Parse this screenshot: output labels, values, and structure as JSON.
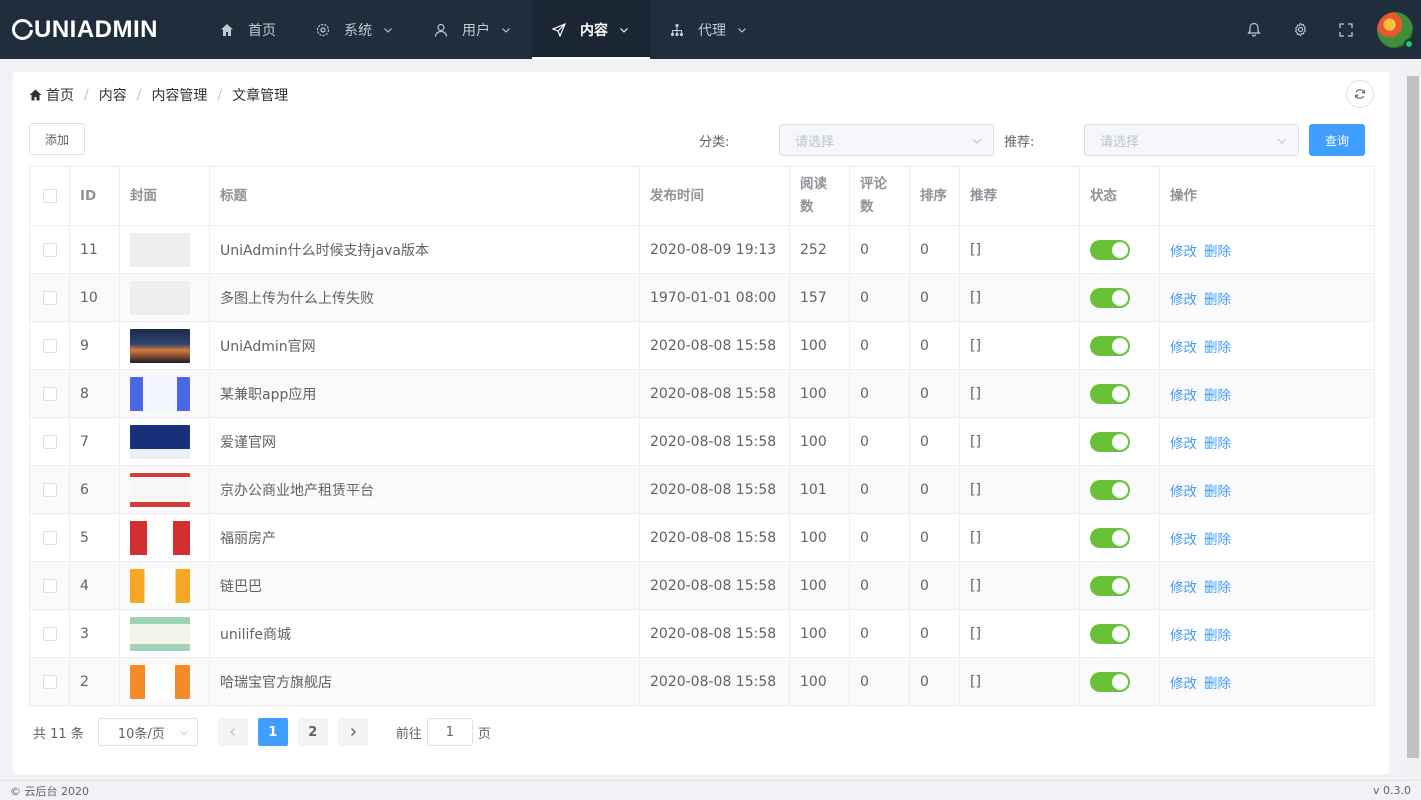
{
  "app": {
    "logo_text": "UNIADMIN",
    "logo_prefix": ""
  },
  "nav": [
    {
      "label": "首页",
      "icon": "home-icon"
    },
    {
      "label": "系统",
      "icon": "gear-icon"
    },
    {
      "label": "用户",
      "icon": "user-icon"
    },
    {
      "label": "内容",
      "icon": "send-icon",
      "active": true
    },
    {
      "label": "代理",
      "icon": "network-icon"
    }
  ],
  "breadcrumb": [
    "首页",
    "内容",
    "内容管理",
    "文章管理"
  ],
  "toolbar": {
    "add_label": "添加",
    "category_label": "分类:",
    "category_placeholder": "请选择",
    "recommend_label": "推荐:",
    "recommend_placeholder": "请选择",
    "query_label": "查询"
  },
  "table": {
    "headers": [
      "ID",
      "封面",
      "标题",
      "发布时间",
      "阅读数",
      "评论数",
      "排序",
      "推荐",
      "状态",
      "操作"
    ],
    "edit_label": "修改",
    "delete_label": "删除",
    "rows": [
      {
        "id": "11",
        "title": "UniAdmin什么时候支持java版本",
        "time": "2020-08-09 19:13",
        "reads": "252",
        "comments": "0",
        "sort": "0",
        "recommend": "[]",
        "status": true,
        "cover": "placeholder"
      },
      {
        "id": "10",
        "title": "多图上传为什么上传失败",
        "time": "1970-01-01 08:00",
        "reads": "157",
        "comments": "0",
        "sort": "0",
        "recommend": "[]",
        "status": true,
        "cover": "placeholder"
      },
      {
        "id": "9",
        "title": "UniAdmin官网",
        "time": "2020-08-08 15:58",
        "reads": "100",
        "comments": "0",
        "sort": "0",
        "recommend": "[]",
        "status": true,
        "cover": "dark"
      },
      {
        "id": "8",
        "title": "某兼职app应用",
        "time": "2020-08-08 15:58",
        "reads": "100",
        "comments": "0",
        "sort": "0",
        "recommend": "[]",
        "status": true,
        "cover": "blue"
      },
      {
        "id": "7",
        "title": "爱谨官网",
        "time": "2020-08-08 15:58",
        "reads": "100",
        "comments": "0",
        "sort": "0",
        "recommend": "[]",
        "status": true,
        "cover": "navy"
      },
      {
        "id": "6",
        "title": "京办公商业地产租赁平台",
        "time": "2020-08-08 15:58",
        "reads": "101",
        "comments": "0",
        "sort": "0",
        "recommend": "[]",
        "status": true,
        "cover": "red"
      },
      {
        "id": "5",
        "title": "福丽房产",
        "time": "2020-08-08 15:58",
        "reads": "100",
        "comments": "0",
        "sort": "0",
        "recommend": "[]",
        "status": true,
        "cover": "crimson"
      },
      {
        "id": "4",
        "title": "链巴巴",
        "time": "2020-08-08 15:58",
        "reads": "100",
        "comments": "0",
        "sort": "0",
        "recommend": "[]",
        "status": true,
        "cover": "orange"
      },
      {
        "id": "3",
        "title": "unilife商城",
        "time": "2020-08-08 15:58",
        "reads": "100",
        "comments": "0",
        "sort": "0",
        "recommend": "[]",
        "status": true,
        "cover": "green"
      },
      {
        "id": "2",
        "title": "哈瑞宝官方旗舰店",
        "time": "2020-08-08 15:58",
        "reads": "100",
        "comments": "0",
        "sort": "0",
        "recommend": "[]",
        "status": true,
        "cover": "amber"
      }
    ]
  },
  "pagination": {
    "total_text": "共 11 条",
    "page_size": "10条/页",
    "pages": [
      "1",
      "2"
    ],
    "current": "1",
    "goto_label": "前往",
    "goto_value": "1",
    "page_suffix": "页"
  },
  "footer": {
    "copyright": "© 云后台 2020",
    "version": "v 0.3.0"
  },
  "colors": {
    "topbar": "#1f2d3d",
    "primary": "#409eff",
    "switch_on": "#67c23a"
  }
}
